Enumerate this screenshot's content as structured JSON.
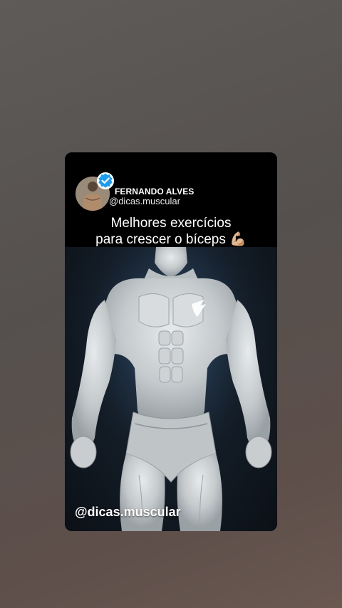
{
  "post": {
    "author_name": "FERNANDO ALVES",
    "author_handle": "@dicas.muscular",
    "title_line1": "Melhores exercícios",
    "title_line2": "para crescer o bíceps 💪🏼",
    "watermark": "@dicas.muscular"
  },
  "icons": {
    "verified": "verified-badge-icon",
    "avatar": "profile-avatar",
    "figure": "muscle-anatomy-figure"
  },
  "colors": {
    "verified_blue": "#1d9bf0",
    "card_bg": "#000000",
    "figure_body": "#c8cdd0"
  }
}
